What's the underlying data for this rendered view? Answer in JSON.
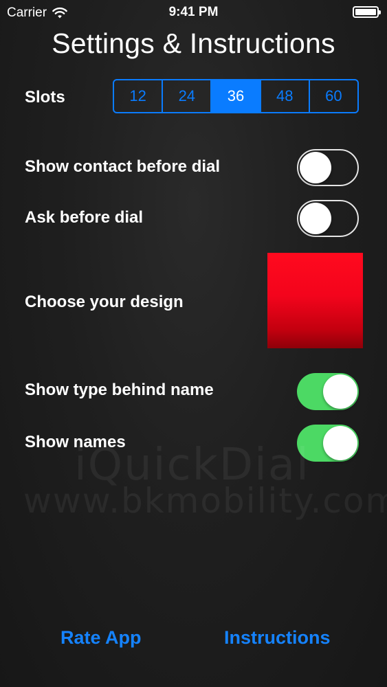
{
  "status_bar": {
    "carrier": "Carrier",
    "time": "9:41 PM"
  },
  "page_title": "Settings & Instructions",
  "slots": {
    "label": "Slots",
    "options": [
      "12",
      "24",
      "36",
      "48",
      "60"
    ],
    "selected": "36"
  },
  "toggles": {
    "show_contact": {
      "label": "Show contact before dial",
      "on": false
    },
    "ask_before_dial": {
      "label": "Ask before dial",
      "on": false
    },
    "show_type": {
      "label": "Show type behind name",
      "on": true
    },
    "show_names": {
      "label": "Show names",
      "on": true
    }
  },
  "design": {
    "label": "Choose your design",
    "color": "#ff0a1e"
  },
  "watermark": {
    "line1": "iQuickDial",
    "line2": "www.bkmobility.com"
  },
  "bottom": {
    "rate_app": "Rate App",
    "instructions": "Instructions"
  },
  "colors": {
    "accent_blue": "#0a7cff",
    "toggle_on_green": "#4cd964",
    "link_blue": "#1583ff"
  }
}
